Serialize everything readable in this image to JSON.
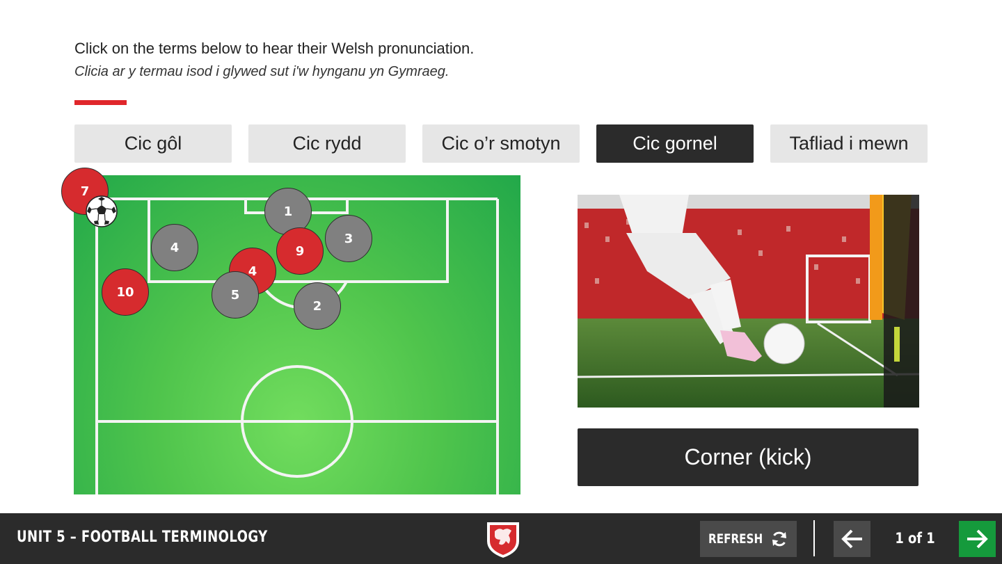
{
  "instructions": {
    "english": "Click on the terms below to hear their Welsh pronunciation.",
    "welsh": "Clicia ar y termau isod i glywed sut i'w hynganu yn Gymraeg."
  },
  "tabs": [
    {
      "label": "Cic gôl",
      "active": false
    },
    {
      "label": "Cic rydd",
      "active": false
    },
    {
      "label": "Cic o’r smotyn",
      "active": false
    },
    {
      "label": "Cic gornel",
      "active": true
    },
    {
      "label": "Tafliad i mewn",
      "active": false
    }
  ],
  "pitch": {
    "players": [
      {
        "number": "7",
        "team": "red"
      },
      {
        "number": "1",
        "team": "grey"
      },
      {
        "number": "4",
        "team": "grey"
      },
      {
        "number": "9",
        "team": "red"
      },
      {
        "number": "3",
        "team": "grey"
      },
      {
        "number": "4",
        "team": "red"
      },
      {
        "number": "10",
        "team": "red"
      },
      {
        "number": "5",
        "team": "grey"
      },
      {
        "number": "2",
        "team": "grey"
      }
    ]
  },
  "answer": {
    "text": "Corner (kick)"
  },
  "footer": {
    "unit_title": "UNIT 5 – FOOTBALL TERMINOLOGY",
    "refresh_label": "REFRESH",
    "page_indicator": "1 of 1"
  },
  "colors": {
    "accent_red": "#e0262b",
    "dark": "#2b2b2b",
    "next_green": "#159a3c",
    "tab_grey": "#e6e6e6"
  },
  "icons": {
    "refresh": "refresh-icon",
    "prev": "arrow-left-icon",
    "next": "arrow-right-icon",
    "crest": "wales-dragon-crest-icon",
    "ball": "football-icon"
  }
}
